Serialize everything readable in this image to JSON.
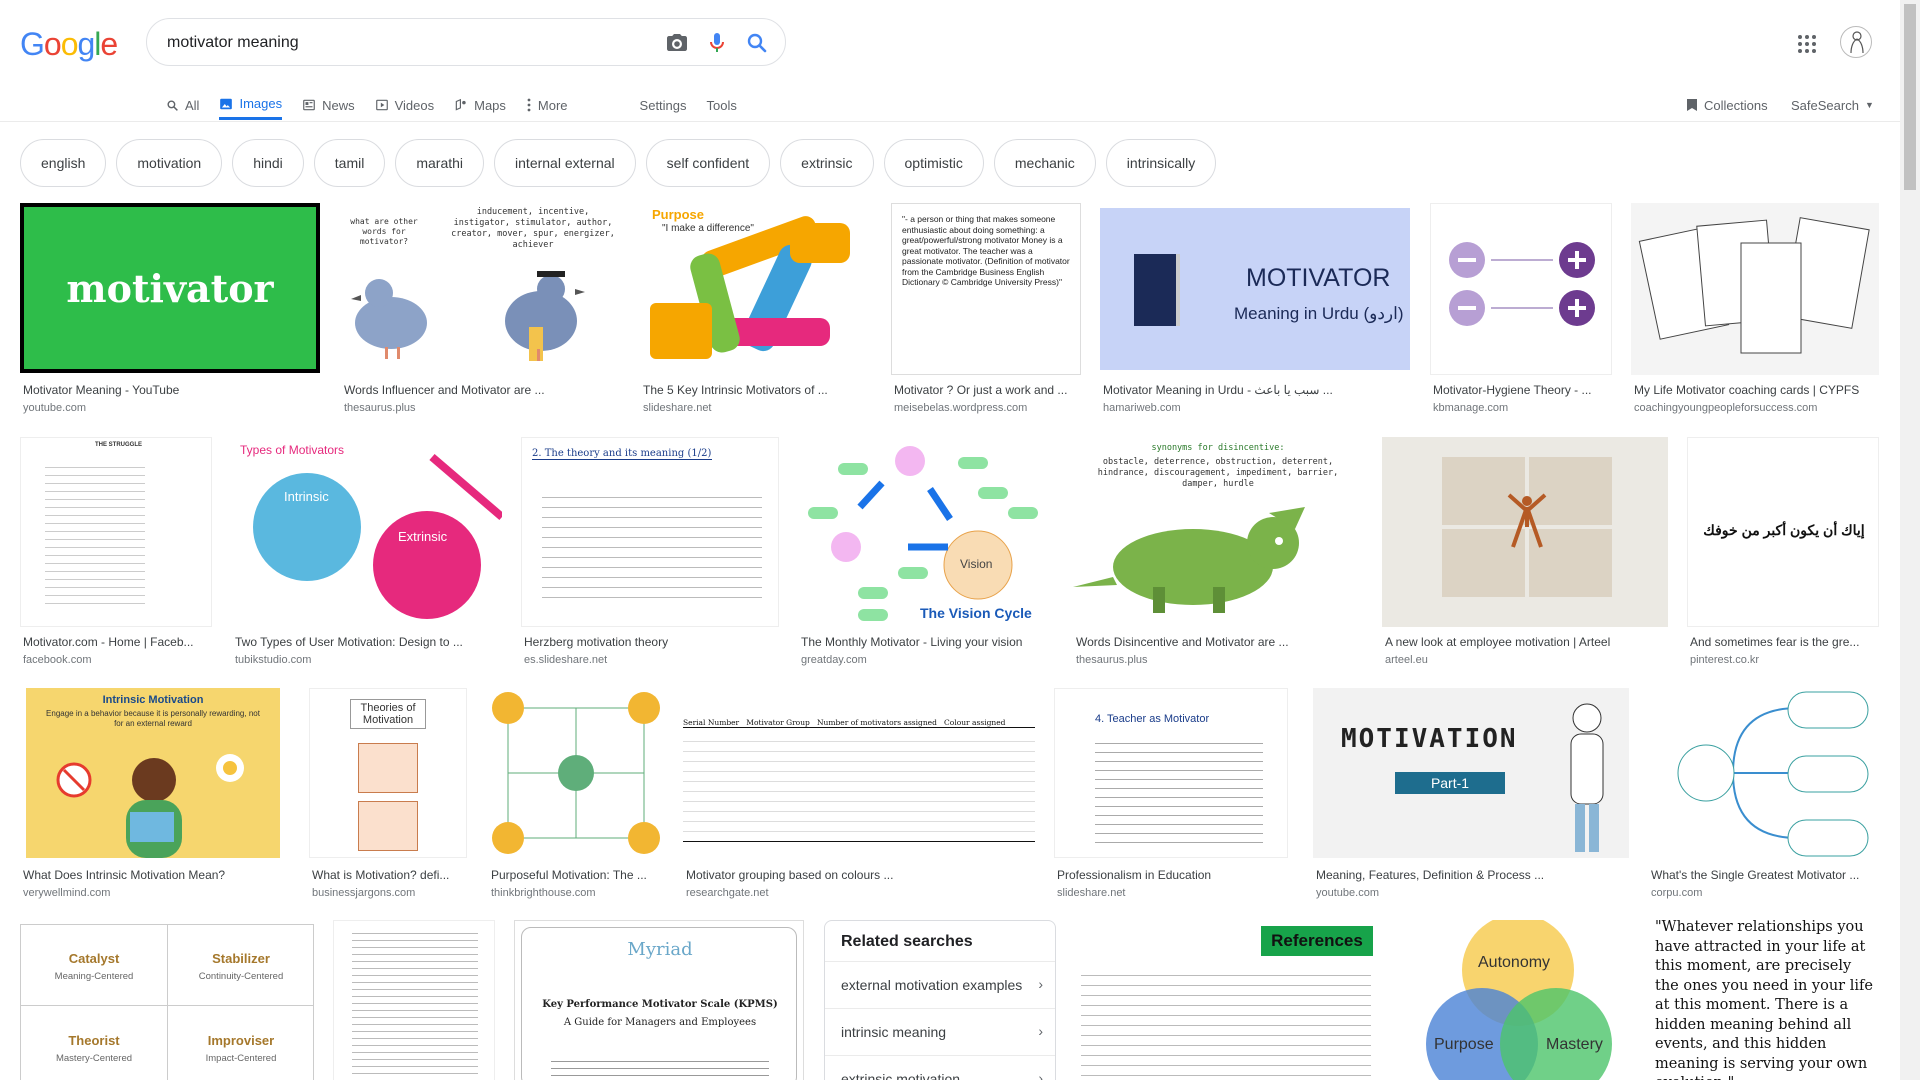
{
  "logo": "Google",
  "search": {
    "query": "motivator meaning"
  },
  "nav": {
    "tabs": [
      {
        "label": "All"
      },
      {
        "label": "Images"
      },
      {
        "label": "News"
      },
      {
        "label": "Videos"
      },
      {
        "label": "Maps"
      },
      {
        "label": "More"
      }
    ],
    "settings": "Settings",
    "tools": "Tools",
    "collections": "Collections",
    "safesearch": "SafeSearch"
  },
  "chips": [
    "english",
    "motivation",
    "hindi",
    "tamil",
    "marathi",
    "internal external",
    "self confident",
    "extrinsic",
    "optimistic",
    "mechanic",
    "intrinsically"
  ],
  "results": [
    {
      "title": "Motivator Meaning - YouTube",
      "source": "youtube.com",
      "img_text": "motivator"
    },
    {
      "title": "Words Influencer and Motivator are ...",
      "source": "thesaurus.plus",
      "img_text": "inducement, incentive, instigator, stimulator, author, creator, mover, spur, energizer, achiever",
      "img_text2": "what are other words for motivator?"
    },
    {
      "title": "The 5 Key Intrinsic Motivators of ...",
      "source": "slideshare.net",
      "img_text": "Purpose",
      "img_text2": "\"I make a difference\""
    },
    {
      "title": "Motivator ? Or just a work and ...",
      "source": "meisebelas.wordpress.com",
      "img_text": "\"- a person or thing that makes someone enthusiastic about doing something: a great/powerful/strong motivator Money is a great motivator. The teacher was a passionate motivator. (Definition of motivator from the Cambridge Business English Dictionary © Cambridge University Press)\""
    },
    {
      "title": "Motivator Meaning in Urdu - سبب یا باعث ...",
      "source": "hamariweb.com",
      "img_text": "MOTIVATOR",
      "img_text2": "Meaning in Urdu (اردو)"
    },
    {
      "title": "Motivator-Hygiene Theory - ...",
      "source": "kbmanage.com"
    },
    {
      "title": "My Life Motivator coaching cards | CYPFS",
      "source": "coachingyoungpeopleforsuccess.com"
    },
    {
      "title": "Motivator.com - Home | Faceb...",
      "source": "facebook.com",
      "img_text": "THE STRUGGLE"
    },
    {
      "title": "Two Types of User Motivation: Design to ...",
      "source": "tubikstudio.com",
      "img_text": "Types of Motivators",
      "img_text2": "Intrinsic",
      "img_text3": "Extrinsic"
    },
    {
      "title": "Herzberg motivation theory",
      "source": "es.slideshare.net",
      "img_text": "2. The theory and its meaning (1/2)"
    },
    {
      "title": "The Monthly Motivator - Living your vision",
      "source": "greatday.com",
      "img_text": "The Vision Cycle",
      "img_text2": "Vision"
    },
    {
      "title": "Words Disincentive and Motivator are ...",
      "source": "thesaurus.plus",
      "img_text": "synonyms for disincentive:",
      "img_text2": "obstacle, deterrence, obstruction, deterrent, hindrance, discouragement, impediment, barrier, damper, hurdle"
    },
    {
      "title": "A new look at employee motivation | Arteel",
      "source": "arteel.eu"
    },
    {
      "title": "And sometimes fear is the gre...",
      "source": "pinterest.co.kr",
      "img_text": "إياك أن يكون أكبر من خوفك"
    },
    {
      "title": "What Does Intrinsic Motivation Mean?",
      "source": "verywellmind.com",
      "img_text": "Intrinsic Motivation",
      "img_text2": "Engage in a behavior because it is personally rewarding, not for an external reward"
    },
    {
      "title": "What is Motivation? defi...",
      "source": "businessjargons.com",
      "img_text": "Theories of Motivation"
    },
    {
      "title": "Purposeful Motivation: The ...",
      "source": "thinkbrighthouse.com"
    },
    {
      "title": "Motivator grouping based on colours ...",
      "source": "researchgate.net",
      "img_text": "Serial Number   Motivator Group   Number of motivators assigned   Colour assigned"
    },
    {
      "title": "Professionalism in Education",
      "source": "slideshare.net",
      "img_text": "4. Teacher as Motivator"
    },
    {
      "title": "Meaning, Features, Definition & Process ...",
      "source": "youtube.com",
      "img_text": "MOTIVATION",
      "img_text2": "Part-1"
    },
    {
      "title": "What's the Single Greatest Motivator ...",
      "source": "corpu.com"
    }
  ],
  "bottom": {
    "catalyst": "Catalyst",
    "catalyst_sub": "Meaning-Centered",
    "stabilizer": "Stabilizer",
    "stabilizer_sub": "Continuity-Centered",
    "theorist": "Theorist",
    "theorist_sub": "Mastery-Centered",
    "improviser": "Improviser",
    "improviser_sub": "Impact-Centered",
    "myriad": "Myriad",
    "kpms_title": "Key Performance Motivator Scale (KPMS)",
    "kpms_sub": "A Guide for Managers and Employees",
    "references": "References",
    "autonomy": "Autonomy",
    "purpose": "Purpose",
    "mastery": "Mastery",
    "quote": "\"Whatever relationships you have attracted in your life at this moment, are precisely the ones you need in your life at this moment. There is a hidden meaning behind all events, and this hidden meaning is serving your own evolution.\""
  },
  "related": {
    "heading": "Related searches",
    "items": [
      "external motivation examples",
      "intrinsic meaning",
      "extrinsic motivation"
    ]
  },
  "colors": {
    "google_blue": "#4285f4",
    "google_red": "#ea4335",
    "google_yellow": "#fbbc05",
    "google_green": "#34a853",
    "active_tab": "#1a73e8"
  }
}
